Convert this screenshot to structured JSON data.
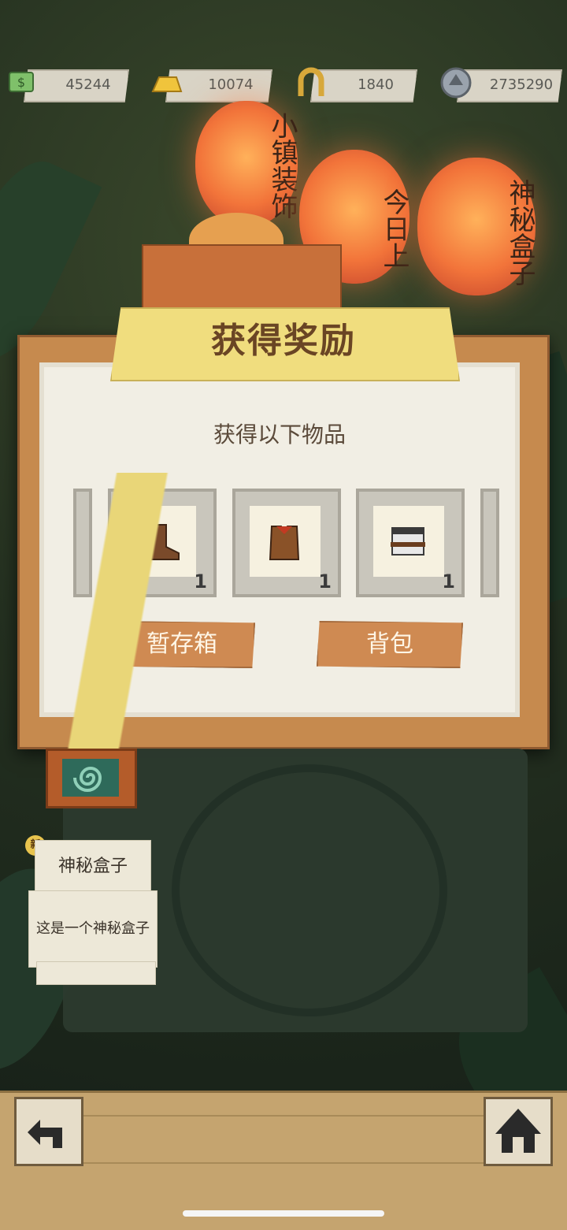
{
  "currency": [
    {
      "icon": "cash-icon",
      "value": "45244"
    },
    {
      "icon": "gold-bar-icon",
      "value": "10074"
    },
    {
      "icon": "horseshoe-icon",
      "value": "1840"
    },
    {
      "icon": "silver-coin-icon",
      "value": "2735290"
    }
  ],
  "lanterns": [
    {
      "label": "小镇装饰"
    },
    {
      "label": "今日上"
    },
    {
      "label": "神秘盒子"
    }
  ],
  "dialog": {
    "title": "获得奖励",
    "subtitle": "获得以下物品",
    "items": [
      {
        "name": "boots-icon",
        "count": "1"
      },
      {
        "name": "vest-icon",
        "count": "1"
      },
      {
        "name": "belt-icon",
        "count": "1"
      }
    ],
    "storage_button": "暂存箱",
    "backpack_button": "背包"
  },
  "tooltip": {
    "badge": "新",
    "title": "神秘盒子",
    "description": "这是一个神秘盒子"
  },
  "colors": {
    "board": "#c68a4e",
    "ribbon": "#f0dd7e",
    "button": "#cf8a52",
    "lantern": "#f2743a"
  }
}
